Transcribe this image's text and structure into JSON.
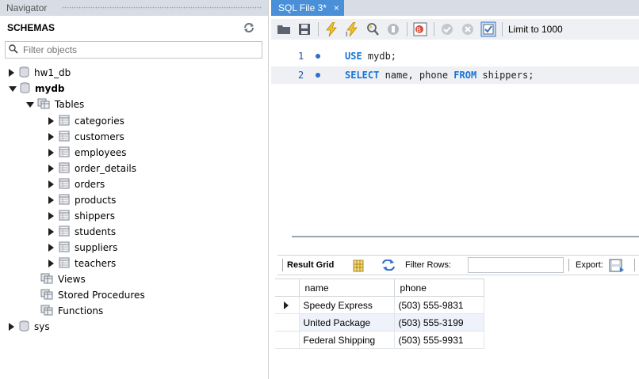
{
  "navigator": {
    "title": "Navigator",
    "schemas_label": "SCHEMAS",
    "filter_placeholder": "Filter objects",
    "tree": {
      "hw1_db": "hw1_db",
      "mydb": "mydb",
      "tables": "Tables",
      "table_items": [
        "categories",
        "customers",
        "employees",
        "order_details",
        "orders",
        "products",
        "shippers",
        "students",
        "suppliers",
        "teachers"
      ],
      "views": "Views",
      "stored_procedures": "Stored Procedures",
      "functions": "Functions",
      "sys": "sys"
    }
  },
  "editor": {
    "tab_label": "SQL File 3*",
    "tab_close": "×",
    "limit_label": "Limit to 1000",
    "lines": [
      {
        "number": "1",
        "keyword": "USE",
        "rest": " mydb;"
      },
      {
        "number": "2",
        "keyword": "SELECT",
        "rest_a": " name, phone ",
        "keyword2": "FROM",
        "rest_b": " shippers;"
      }
    ]
  },
  "results": {
    "result_grid_label": "Result Grid",
    "filter_rows_label": "Filter Rows:",
    "export_label": "Export:",
    "columns": [
      "name",
      "phone"
    ],
    "rows": [
      [
        "Speedy Express",
        "(503) 555-9831"
      ],
      [
        "United Package",
        "(503) 555-3199"
      ],
      [
        "Federal Shipping",
        "(503) 555-9931"
      ]
    ]
  },
  "colors": {
    "tab_active": "#4a90d9",
    "keyword": "#1574d6",
    "line_number": "#1e4fb0"
  }
}
